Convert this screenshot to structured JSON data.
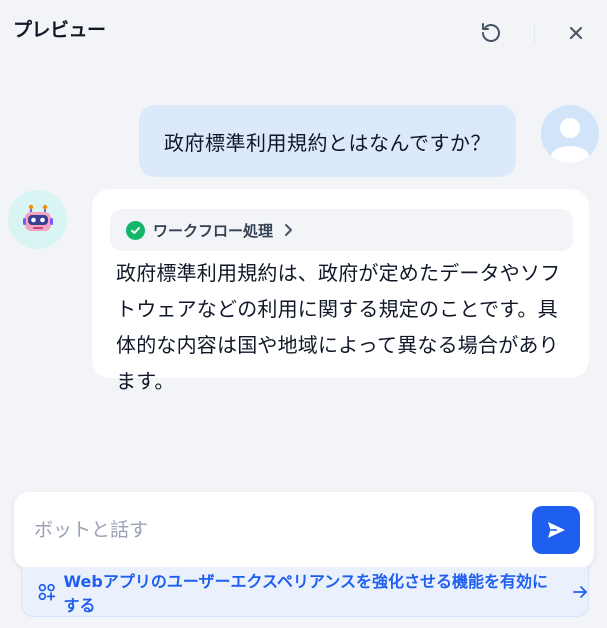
{
  "header": {
    "title": "プレビュー"
  },
  "messages": {
    "user_text": "政府標準利用規約とはなんですか？",
    "workflow_label": "ワークフロー処理",
    "bot_text": "政府標準利用規約は、政府が定めたデータやソフトウェアなどの利用に関する規定のことです。具体的な内容は国や地域によって異なる場合があります。"
  },
  "input": {
    "placeholder": "ボットと話す",
    "value": ""
  },
  "banner": {
    "text": "Webアプリのユーザーエクスペリアンスを強化させる機能を有効にする"
  },
  "colors": {
    "accent": "#1f5ff0",
    "user_bubble": "#dce9fb",
    "success": "#12b76a",
    "background": "#f2f4f7"
  },
  "icons": {
    "refresh": "refresh-icon",
    "close": "close-icon",
    "user_avatar": "user-avatar-icon",
    "bot_avatar": "robot-icon",
    "check": "check-circle-icon",
    "chevron": "chevron-right-icon",
    "send": "send-icon",
    "feature": "grid-plus-icon",
    "arrow": "arrow-right-icon"
  }
}
